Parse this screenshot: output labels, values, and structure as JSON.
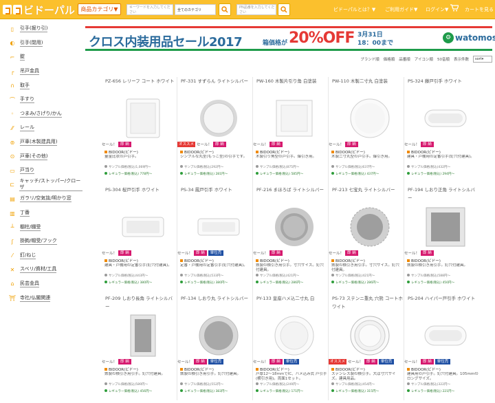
{
  "header": {
    "logo_text": "ビドーパル",
    "category_button": "商品カテゴリ▼",
    "keyword_placeholder": "キーワードを入力してください",
    "category_select": "全てのカテゴリ",
    "partno_placeholder": "PN品番を入力してください",
    "nav": [
      "ビドーパルとは？▼",
      "ご利用ガイド▼",
      "ログイン▼",
      "カートを見る"
    ]
  },
  "sidebar": {
    "items": [
      {
        "icon": "pull-handle-icon",
        "label": "引手(掘り引)"
      },
      {
        "icon": "round-pull-icon",
        "label": "引手(閉用)"
      },
      {
        "icon": "lock-icon",
        "label": "錠"
      },
      {
        "icon": "hanger-icon",
        "label": "吊戸金具"
      },
      {
        "icon": "handle-icon",
        "label": "取手"
      },
      {
        "icon": "handrail-icon",
        "label": "手すり"
      },
      {
        "icon": "knob-icon",
        "label": "つまみ/さげり/かん"
      },
      {
        "icon": "rail-icon",
        "label": "レール"
      },
      {
        "icon": "door-wheel-icon",
        "label": "戸車(木製建具用)"
      },
      {
        "icon": "door-wheel-2-icon",
        "label": "戸車(その他)"
      },
      {
        "icon": "door-stop-icon",
        "label": "戸当り"
      },
      {
        "icon": "catch-icon",
        "label": "キャッチ/ストッパー/クローザ"
      },
      {
        "icon": "glass-icon",
        "label": "ガラリ/空気抜/明かり窓"
      },
      {
        "icon": "hinge-icon",
        "label": "丁番"
      },
      {
        "icon": "bracket-icon",
        "label": "棚柱/棚受"
      },
      {
        "icon": "hook-icon",
        "label": "掛鉤/帽受/フック"
      },
      {
        "icon": "nail-icon",
        "label": "釘/ねじ"
      },
      {
        "icon": "slide-icon",
        "label": "スベリ/資材/工具"
      },
      {
        "icon": "house-icon",
        "label": "民芸金具"
      },
      {
        "icon": "temple-icon",
        "label": "寺社/仏閣関連"
      }
    ]
  },
  "banner": {
    "title": "クロス内装用品セール2017",
    "sub": "箱価格が",
    "off": "20%OFF",
    "date_line1": "3月31日",
    "date_line2": "18：00まで",
    "brand": "watomos"
  },
  "sortbar": {
    "links": [
      "ブランド順",
      "価格順",
      "品番順",
      "アイコン順",
      "50音順"
    ],
    "label": "表示件数",
    "select_value": "sort"
  },
  "products": [
    {
      "name": "PZ-656 レリーフ コート ホワイト",
      "shape": "rect-plate",
      "rec": false,
      "sale": "セール！",
      "stock": "即 納",
      "unit": "",
      "brand": "BIDOOR(ビドー)",
      "desc": "量金比状の戸引手。",
      "price": "サンプル価格(税込)1,069円～",
      "dprice": "レギュラー価格(税込) 778円～"
    },
    {
      "name": "PF-331 すずらん ライトシルバー",
      "shape": "round-ring",
      "rec": true,
      "sale": "セール！",
      "stock": "即 納",
      "unit": "",
      "brand": "BIDOOR(ビドー)",
      "desc": "シンプルな丸型(もっこ型)の引手です。",
      "price": "サンプル価格(税込)292円～",
      "dprice": "レギュラー価格(税込) 281円～"
    },
    {
      "name": "PW-160 木製片引り角 白塗装",
      "shape": "square-white",
      "rec": false,
      "sale": "セール！",
      "stock": "即 納",
      "unit": "",
      "brand": "BIDOOR(ビドー)",
      "desc": "木製引り角型の戸引手。爆引き用。",
      "price": "サンプル価格(税込)875円～",
      "dprice": "レギュラー価格(税込) 585円～"
    },
    {
      "name": "PW-110 木製二寸丸 白塗装",
      "shape": "round-white",
      "rec": false,
      "sale": "セール！",
      "stock": "即 納",
      "unit": "",
      "brand": "BIDOOR(ビドー)",
      "desc": "木製二寸丸型の戸引手。爆引き用。",
      "price": "サンプル価格(税込)637円～",
      "dprice": "レギュラー価格(税込) 437円～"
    },
    {
      "name": "PS-324 藤戸引手 ホワイト",
      "shape": "long-oval",
      "rec": false,
      "sale": "セール！",
      "stock": "即 納",
      "unit": "",
      "brand": "BIDOOR(ビドー)",
      "desc": "建具・戸棚用の定番引手(釘穴付建具)。",
      "price": "サンプル価格(税込)432円～",
      "dprice": "レギュラー価格(税込) 294円～"
    },
    {
      "name": "PS-304 桜戸引手 ホワイト",
      "shape": "long-rect",
      "rec": false,
      "sale": "セール！",
      "stock": "即 納",
      "unit": "",
      "brand": "BIDOOR(ビドー)",
      "desc": "建具・戸棚用の定番引手(釘穴付建具)。",
      "price": "サンプル価格(税込)443円～",
      "dprice": "レギュラー価格(税込) 380円～"
    },
    {
      "name": "PS-34 鳳戸引手 ホワイト",
      "shape": "long-rect-2",
      "rec": false,
      "sale": "セール！",
      "stock": "即 納",
      "unit": "単位売",
      "brand": "BIDOOR(ビドー)",
      "desc": "定番・戸棚用の定番引手(釘穴付建具)。",
      "price": "サンプル価格(税込)533円～",
      "dprice": "レギュラー価格(税込) 380円～"
    },
    {
      "name": "PF-216 まほろば ライトシルバー",
      "shape": "round-ring-grey",
      "rec": false,
      "sale": "セール！",
      "stock": "即 納",
      "unit": "",
      "brand": "BIDOOR(ビドー)",
      "desc": "鉄製の横引き用引手。寸穴サイズ。釘穴付建具。",
      "price": "サンプル価格(税込)421円～",
      "dprice": "レギュラー価格(税込) 286円～"
    },
    {
      "name": "PF-213 七宝丸 ライトシルバー",
      "shape": "round-ornate",
      "rec": false,
      "sale": "セール！",
      "stock": "即 納",
      "unit": "",
      "brand": "BIDOOR(ビドー)",
      "desc": "鉄製の横引き用引手。寸穴サイズ。釘穴付建具。",
      "price": "サンプル価格(税込)421円～",
      "dprice": "レギュラー価格(税込) 286円～"
    },
    {
      "name": "PF-194 しおり正角 ライトシルバー",
      "shape": "square-grey",
      "rec": false,
      "sale": "セール！",
      "stock": "即 納",
      "unit": "",
      "brand": "BIDOOR(ビドー)",
      "desc": "鉄製の横引き用引手。釘穴付建具。",
      "price": "サンプル価格(税込)588円～",
      "dprice": "レギュラー価格(税込) 450円～"
    },
    {
      "name": "PF-209 しおり長角 ライトシルバー",
      "shape": "tall-rect-grey",
      "rec": false,
      "sale": "セール！",
      "stock": "即 納",
      "unit": "",
      "brand": "BIDOOR(ビドー)",
      "desc": "鉄製の横引き用引手。釘穴付建具。",
      "price": "サンプル価格(税込)589円～",
      "dprice": "レギュラー価格(税込) 456円～"
    },
    {
      "name": "PF-134 しおり丸 ライトシルバー",
      "shape": "round-grey",
      "rec": false,
      "sale": "セール！",
      "stock": "即 納",
      "unit": "単位売",
      "brand": "BIDOOR(ビドー)",
      "desc": "鉄製の横引き用引手。釘穴付建具。",
      "price": "サンプル価格(税込)552円～",
      "dprice": "レギュラー価格(税込) 383円～"
    },
    {
      "name": "PY-133 皇座ハメ込二寸丸 白",
      "shape": "round-white-2",
      "rec": false,
      "sale": "セール！",
      "stock": "即 納",
      "unit": "単位売",
      "brand": "BIDOOR(ビドー)",
      "desc": "戸厚12～18mmでIC、ハメ込み式 戸引手(横引き用)。両面1セット。",
      "price": "サンプル価格(税込)249円～",
      "dprice": "レギュラー価格(税込) 171円～"
    },
    {
      "name": "PS-73 ステンニ重丸 穴熊 コートホワイト",
      "shape": "round-double",
      "rec": true,
      "sale": "セール！",
      "stock": "即 納",
      "unit": "単位売",
      "brand": "BIDOOR(ビドー)",
      "desc": "ステンレス製の横引手。大は寸穴サイズ。建具用品。",
      "price": "サンプル価格(税込)454円～",
      "dprice": "レギュラー価格(税込) 315円～"
    },
    {
      "name": "PS-204 ハイパー戸引手 ホワイト",
      "shape": "long-oval-2",
      "rec": false,
      "sale": "セール！",
      "stock": "即 納",
      "unit": "単位売",
      "brand": "BIDOOR(ビドー)",
      "desc": "建具用の戸引手。釘穴付建具。105mmのロングサイズ。",
      "price": "サンプル価格(税込)322円～",
      "dprice": "レギュラー価格(税込) 221円～"
    }
  ]
}
